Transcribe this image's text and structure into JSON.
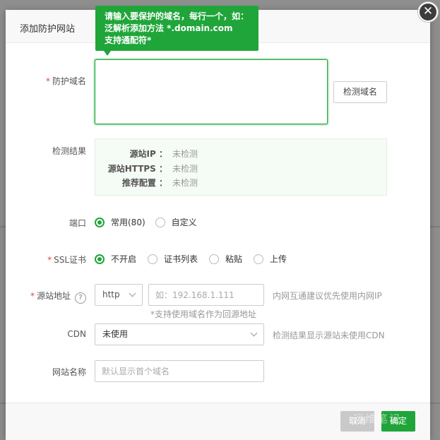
{
  "dialog": {
    "title": "添加防护网站",
    "close_glyph": "✕"
  },
  "tooltip": {
    "lines": [
      "请输入要保护的域名，每行一个，如：",
      "泛解析添加方法 *.domain.com",
      "支持通配符*"
    ]
  },
  "form": {
    "domain": {
      "label": "防护域名",
      "required_mark": "*",
      "value": "",
      "check_button": "检测域名"
    },
    "check_result": {
      "label": "检测结果",
      "rows": [
        {
          "key": "源站IP ：",
          "value": "未检测"
        },
        {
          "key": "源站HTTPS ：",
          "value": "未检测"
        },
        {
          "key": "推荐配置 ：",
          "value": "未检测"
        }
      ]
    },
    "port": {
      "label": "端口",
      "options": [
        {
          "label": "常用(80)",
          "checked": true
        },
        {
          "label": "自定义",
          "checked": false
        }
      ]
    },
    "ssl": {
      "label": "SSL证书",
      "required_mark": "*",
      "options": [
        {
          "label": "不开启",
          "checked": true
        },
        {
          "label": "证书列表",
          "checked": false
        },
        {
          "label": "粘贴",
          "checked": false
        },
        {
          "label": "上传",
          "checked": false
        }
      ]
    },
    "origin": {
      "label": "源站地址",
      "required_mark": "*",
      "help_glyph": "?",
      "protocol": "http",
      "placeholder": "如：192.168.1.111",
      "hint": "内网互通建议优先使用内网IP",
      "subhint": "*支持使用域名作为回源地址"
    },
    "cdn": {
      "label": "CDN",
      "value": "未使用",
      "hint": "检测结果显示源站未使用CDN"
    },
    "site_name": {
      "label": "网站名称",
      "placeholder": "默认显示首个域名"
    }
  },
  "footer": {
    "cancel": "取消",
    "confirm": "确定"
  },
  "watermark": "运维笔记",
  "colors": {
    "accent": "#20a53a",
    "required": "#e14343",
    "cancel_bg": "#c9c9c9"
  }
}
